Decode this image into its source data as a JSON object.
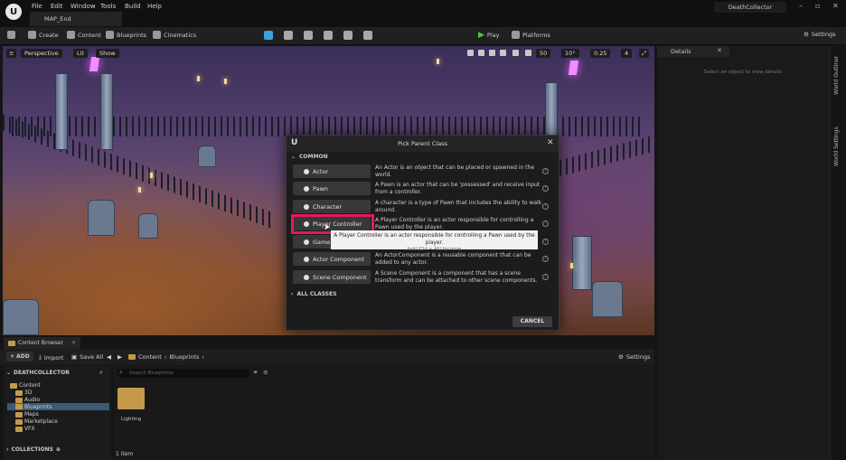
{
  "titlebar": {
    "menus": [
      "File",
      "Edit",
      "Window",
      "Tools",
      "Build",
      "Help"
    ],
    "map_tab": "MAP_End",
    "project_name": "DeathCollector"
  },
  "toolbar": {
    "create": "Create",
    "content": "Content",
    "blueprints": "Blueprints",
    "cinematics": "Cinematics",
    "play": "Play",
    "platforms": "Platforms",
    "settings": "Settings"
  },
  "viewport": {
    "perspective": "Perspective",
    "lit": "Lit",
    "show": "Show",
    "grid_snap": "50",
    "rotation_snap": "10°",
    "scale_snap": "0.25",
    "camera_speed": "4"
  },
  "dialog": {
    "title": "Pick Parent Class",
    "common_header": "COMMON",
    "classes": [
      {
        "label": "Actor",
        "description": "An Actor is an object that can be placed or spawned in the world."
      },
      {
        "label": "Pawn",
        "description": "A Pawn is an actor that can be 'possessed' and receive input from a controller."
      },
      {
        "label": "Character",
        "description": "A character is a type of Pawn that includes the ability to walk around."
      },
      {
        "label": "Player Controller",
        "description": "A Player Controller is an actor responsible for controlling a Pawn used by the player."
      },
      {
        "label": "Game Mode Base",
        "description": ""
      },
      {
        "label": "Actor Component",
        "description": "An ActorComponent is a reusable component that can be added to any actor."
      },
      {
        "label": "Scene Component",
        "description": "A Scene Component is a component that has a scene transform and can be attached to other scene components."
      }
    ],
    "all_classes": "ALL CLASSES",
    "cancel": "CANCEL",
    "tooltip_line1": "A Player Controller is an actor responsible for controlling a Pawn used by the player.",
    "tooltip_line2": "hold (Ctrl + Alt) for more"
  },
  "details": {
    "title": "Details",
    "empty_text": "Select an object to view details."
  },
  "right_sidebar": {
    "world_outliner": "World Outliner",
    "world_settings": "World Settings"
  },
  "content_browser": {
    "tab": "Content Browser",
    "add": "ADD",
    "import": "Import",
    "save_all": "Save All",
    "breadcrumb": [
      "Content",
      "Blueprints"
    ],
    "settings": "Settings",
    "project": "DEATHCOLLECTOR",
    "search_placeholder": "Search Blueprints",
    "tree": [
      "Content",
      "3D",
      "Audio",
      "Blueprints",
      "Maps",
      "Marketplace",
      "VFX"
    ],
    "collections": "COLLECTIONS",
    "folder_name": "Lighting",
    "item_count": "1 item"
  }
}
